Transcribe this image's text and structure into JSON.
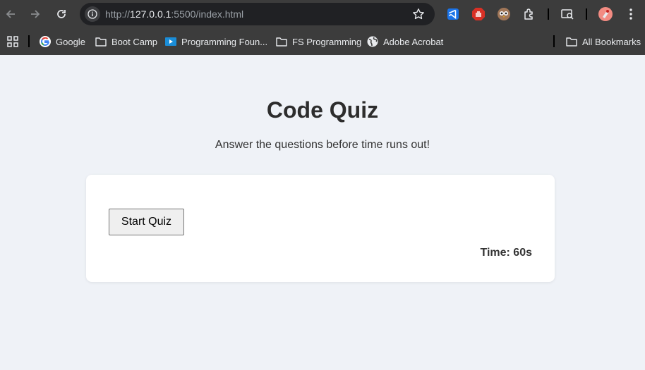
{
  "browser": {
    "url_prefix": "http://",
    "url_host": "127.0.0.1",
    "url_rest": ":5500/index.html",
    "bookmarks": [
      {
        "label": "Google",
        "icon": "google-icon"
      },
      {
        "label": "Boot Camp",
        "icon": "folder-icon"
      },
      {
        "label": "Programming Foun...",
        "icon": "video-icon"
      },
      {
        "label": "FS Programming",
        "icon": "folder-icon"
      },
      {
        "label": "Adobe Acrobat",
        "icon": "globe-icon"
      }
    ],
    "all_bookmarks": "All Bookmarks",
    "colors": {
      "chrome": "#3c3c3c",
      "omnibox": "#202124",
      "text": "#e8eaed"
    }
  },
  "page": {
    "title": "Code Quiz",
    "subtitle": "Answer the questions before time runs out!",
    "start_button": "Start Quiz",
    "timer": "Time: 60s",
    "colors": {
      "background": "#eff2f7",
      "card": "#ffffff",
      "heading": "#2d2d2d"
    }
  }
}
